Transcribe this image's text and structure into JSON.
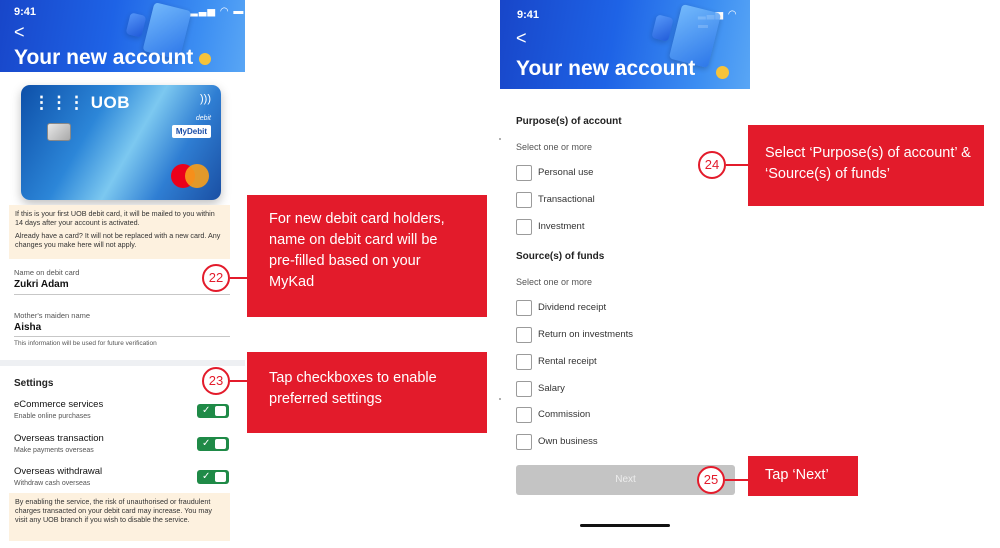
{
  "left_screen": {
    "status_time": "9:41",
    "status_icons": "▂▃▅ ◠ ▬",
    "back_glyph": "<",
    "title": "Your new account",
    "card": {
      "brand": "UOB",
      "contactless": ")))",
      "type_label": "debit",
      "network_badge": "MyDebit"
    },
    "info_note": {
      "line1": "If this is your first UOB debit card, it will be mailed to you within 14 days after your account is activated.",
      "line2": "Already have a card? It will not be replaced with a new card. Any changes you make here will not apply."
    },
    "name_field": {
      "label": "Name on debit card",
      "value": "Zukri Adam"
    },
    "maiden_field": {
      "label": "Mother's maiden name",
      "value": "Aisha",
      "note": "This information will be used for future verification"
    },
    "settings": {
      "title": "Settings",
      "items": [
        {
          "name": "eCommerce services",
          "sub": "Enable online purchases",
          "enabled": true
        },
        {
          "name": "Overseas transaction",
          "sub": "Make payments overseas",
          "enabled": true
        },
        {
          "name": "Overseas withdrawal",
          "sub": "Withdraw cash overseas",
          "enabled": true
        }
      ],
      "warning": "By enabling the service, the risk of unauthorised or fraudulent charges transacted on your debit card may increase. You may visit any UOB branch if you wish to disable the service."
    }
  },
  "right_screen": {
    "status_time": "9:41",
    "status_icons": "▂▃▅ ◠ ▬",
    "back_glyph": "<",
    "title": "Your new account",
    "purpose": {
      "title": "Purpose(s) of account",
      "hint": "Select one or more",
      "options": [
        "Personal use",
        "Transactional",
        "Investment"
      ]
    },
    "source": {
      "title": "Source(s) of funds",
      "hint": "Select one or more",
      "options": [
        "Dividend receipt",
        "Return on investments",
        "Rental receipt",
        "Salary",
        "Commission",
        "Own business"
      ]
    },
    "next_label": "Next"
  },
  "callouts": {
    "c22": {
      "number": "22",
      "text": "For new debit card holders, name on debit card will be pre-filled based on your MyKad"
    },
    "c23": {
      "number": "23",
      "text": "Tap checkboxes to enable preferred settings"
    },
    "c24": {
      "number": "24",
      "text": "Select ‘Purpose(s) of account’ & ‘Source(s) of funds’"
    },
    "c25": {
      "number": "25",
      "text": "Tap ‘Next’"
    }
  },
  "colors": {
    "callout_red": "#e31b2b",
    "header_blue": "#1e63e6",
    "toggle_green": "#1f8a47",
    "note_bg": "#fdf1df",
    "button_disabled": "#c4c4c4"
  },
  "icons": {
    "back": "chevron-left-icon",
    "toggle_tick": "check-icon",
    "contactless": "contactless-icon"
  }
}
